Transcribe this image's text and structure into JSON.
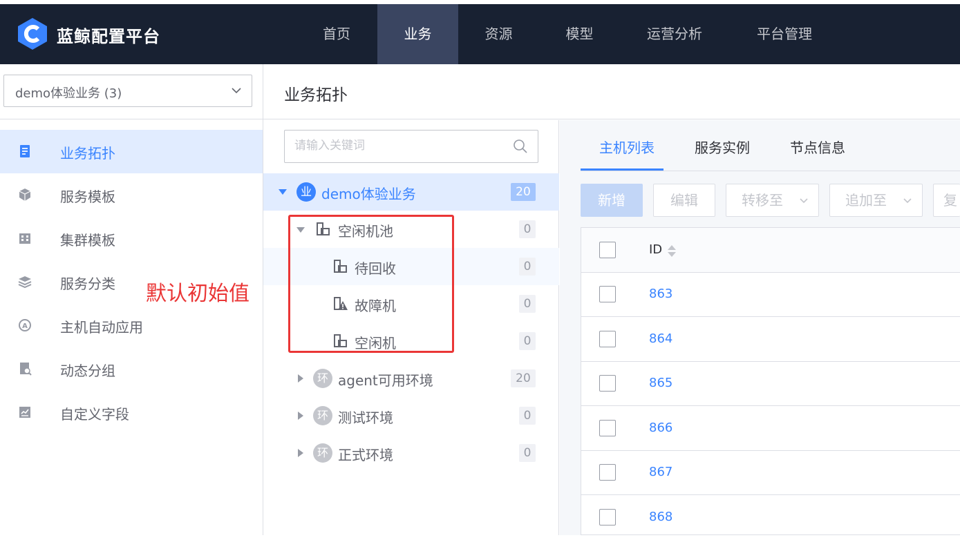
{
  "app": {
    "title": "蓝鲸配置平台",
    "accent": "#3a84ff",
    "header_bg": "#182132"
  },
  "nav": {
    "items": [
      {
        "label": "首页",
        "active": false
      },
      {
        "label": "业务",
        "active": true
      },
      {
        "label": "资源",
        "active": false
      },
      {
        "label": "模型",
        "active": false
      },
      {
        "label": "运营分析",
        "active": false
      },
      {
        "label": "平台管理",
        "active": false
      }
    ]
  },
  "sidebar": {
    "business_select": "demo体验业务 (3)",
    "items": [
      {
        "label": "业务拓扑",
        "icon": "topology-icon",
        "active": true
      },
      {
        "label": "服务模板",
        "icon": "cube-icon",
        "active": false
      },
      {
        "label": "集群模板",
        "icon": "building-icon",
        "active": false
      },
      {
        "label": "服务分类",
        "icon": "layers-icon",
        "active": false
      },
      {
        "label": "主机自动应用",
        "icon": "auto-apply-icon",
        "active": false
      },
      {
        "label": "动态分组",
        "icon": "dynamic-group-icon",
        "active": false
      },
      {
        "label": "自定义字段",
        "icon": "custom-field-icon",
        "active": false
      }
    ],
    "annotation": "默认初始值"
  },
  "page": {
    "title": "业务拓扑"
  },
  "tree": {
    "search_placeholder": "请输入关键词",
    "root": {
      "badge": "业",
      "label": "demo体验业务",
      "count": "20"
    },
    "idle_pool": {
      "label": "空闲机池",
      "count": "0"
    },
    "idle_children": [
      {
        "label": "待回收",
        "count": "0",
        "icon": "host-icon"
      },
      {
        "label": "故障机",
        "count": "0",
        "icon": "fault-host-icon"
      },
      {
        "label": "空闲机",
        "count": "0",
        "icon": "host-icon"
      }
    ],
    "envs": [
      {
        "badge": "环",
        "label": "agent可用环境",
        "count": "20"
      },
      {
        "badge": "环",
        "label": "测试环境",
        "count": "0"
      },
      {
        "badge": "环",
        "label": "正式环境",
        "count": "0"
      }
    ]
  },
  "content": {
    "tabs": [
      {
        "label": "主机列表",
        "active": true
      },
      {
        "label": "服务实例",
        "active": false
      },
      {
        "label": "节点信息",
        "active": false
      }
    ],
    "buttons": {
      "add": "新增",
      "edit": "编辑",
      "transfer": "转移至",
      "append": "追加至",
      "copy": "复"
    },
    "table": {
      "id_header": "ID",
      "rows": [
        "863",
        "864",
        "865",
        "866",
        "867",
        "868"
      ]
    }
  }
}
